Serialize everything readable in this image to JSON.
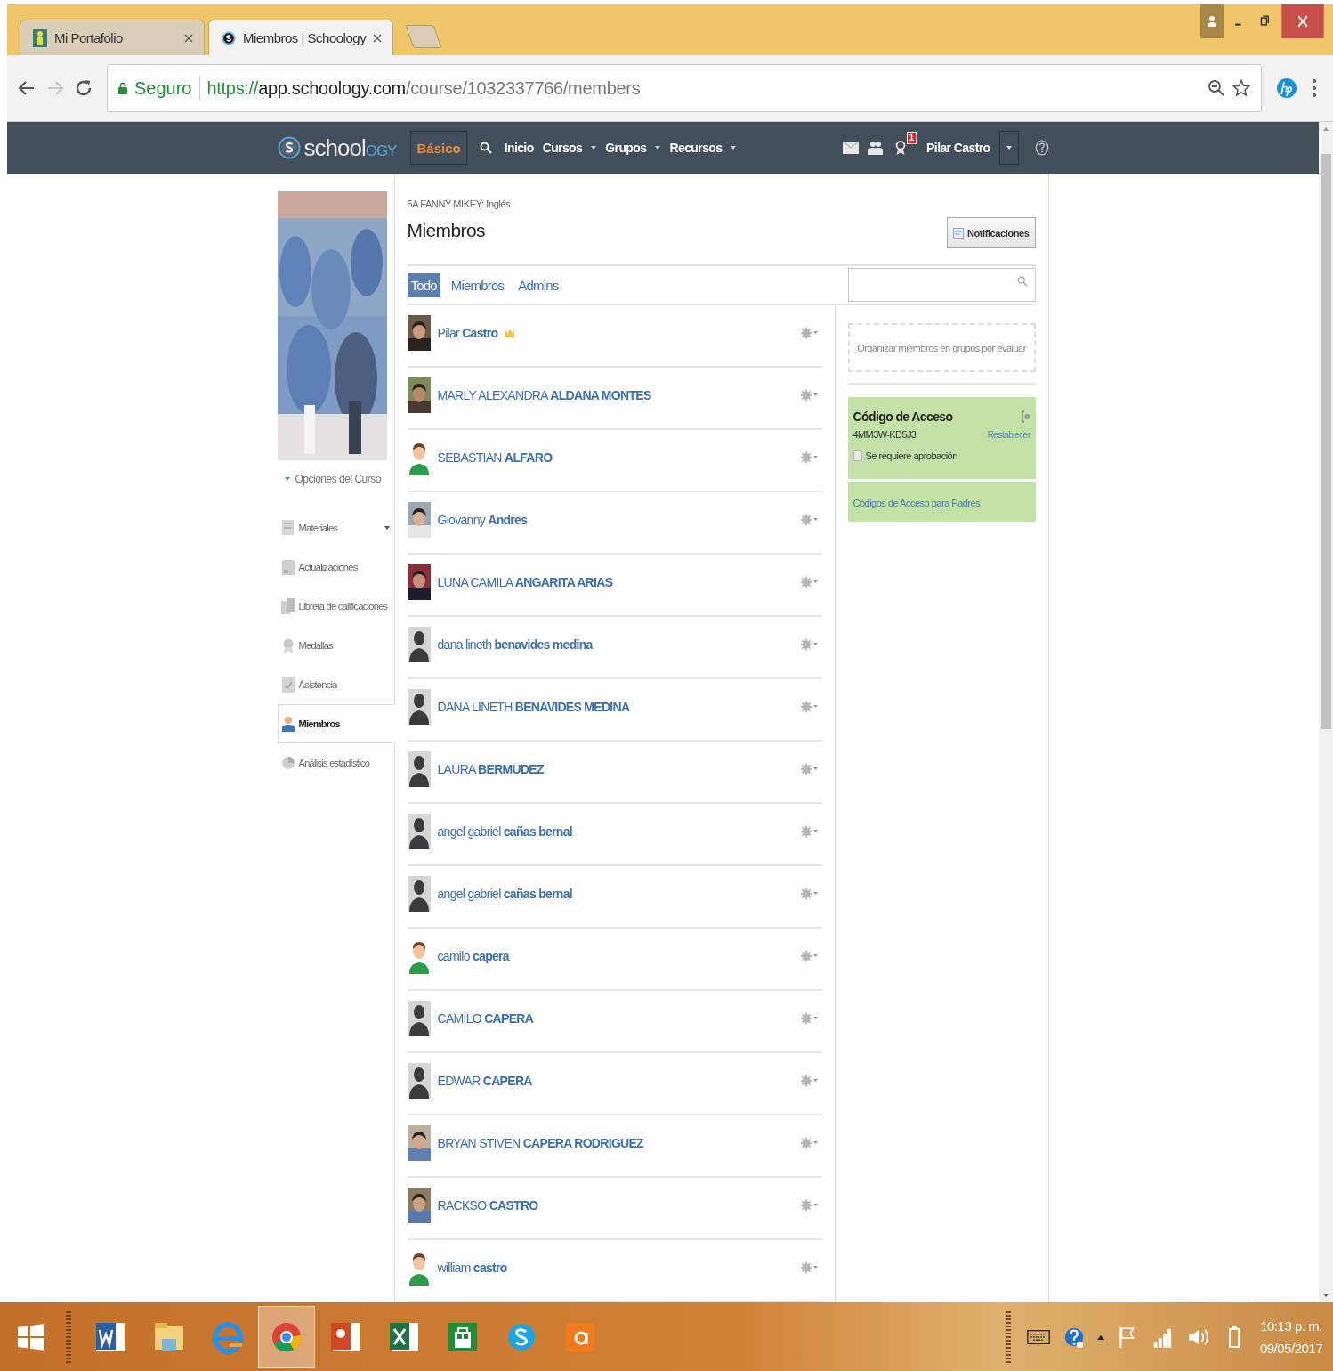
{
  "browser": {
    "tabs": [
      {
        "title": "Mi Portafolio",
        "kind": "portfolio",
        "selected": false
      },
      {
        "title": "Miembros | Schoology",
        "kind": "schoology",
        "selected": true
      }
    ],
    "nav_buttons": [
      {
        "kind": "back",
        "disabled": false
      },
      {
        "kind": "forward",
        "disabled": true
      },
      {
        "kind": "reload",
        "disabled": false
      }
    ],
    "security": "Seguro",
    "url": {
      "scheme": "https://",
      "host": "app.schoology.com",
      "path": "/course/1032337766/members"
    }
  },
  "nav": {
    "logo": {
      "main": "school",
      "accent": "OGY"
    },
    "mode": "Básico",
    "links": [
      {
        "label": "Inicio",
        "menu": false
      },
      {
        "label": "Cursos",
        "menu": true
      },
      {
        "label": "Grupos",
        "menu": true
      },
      {
        "label": "Recursos",
        "menu": true
      }
    ],
    "notification_count": "1",
    "user": "Pilar Castro"
  },
  "sidebar": {
    "options_label": "Opciones del Curso",
    "items": [
      {
        "label": "Materiales",
        "kind": "materials",
        "menu": true,
        "selected": false
      },
      {
        "label": "Actualizaciones",
        "kind": "updates",
        "menu": false,
        "selected": false
      },
      {
        "label": "Libreta de calificaciones",
        "kind": "gradebook",
        "menu": false,
        "selected": false
      },
      {
        "label": "Medallas",
        "kind": "badges",
        "menu": false,
        "selected": false
      },
      {
        "label": "Asistencia",
        "kind": "attendance",
        "menu": false,
        "selected": false
      },
      {
        "label": "Miembros",
        "kind": "members",
        "menu": false,
        "selected": true
      },
      {
        "label": "Análisis estadístico",
        "kind": "analytics",
        "menu": false,
        "selected": false
      }
    ]
  },
  "course": "5A FANNY MIKEY: Inglés",
  "title": "Miembros",
  "notifications_button": "Notificaciones",
  "filter_tabs": [
    {
      "label": "Todo",
      "selected": true
    },
    {
      "label": "Miembros",
      "selected": false
    },
    {
      "label": "Admins",
      "selected": false
    }
  ],
  "members": [
    {
      "name": "Pilar **Castro**",
      "admin": true
    },
    {
      "name": "MARLY ALEXANDRA **ALDANA MONTES**",
      "admin": false
    },
    {
      "name": "SEBASTIAN **ALFARO**",
      "kind": "figure",
      "admin": false
    },
    {
      "name": "Giovanny **Andres**",
      "admin": false
    },
    {
      "name": "LUNA CAMILA **ANGARITA ARIAS**",
      "admin": false
    },
    {
      "name": "dana lineth **benavides medina**",
      "kind": "silhouette",
      "admin": false
    },
    {
      "name": "DANA LINETH **BENAVIDES MEDINA**",
      "kind": "silhouette",
      "admin": false
    },
    {
      "name": "LAURA **BERMUDEZ**",
      "kind": "silhouette",
      "admin": false
    },
    {
      "name": "angel gabriel **cañas bernal**",
      "kind": "silhouette",
      "admin": false
    },
    {
      "name": "angel gabriel **cañas bernal**",
      "kind": "silhouette",
      "admin": false
    },
    {
      "name": "camilo **capera**",
      "kind": "figure",
      "admin": false
    },
    {
      "name": "CAMILO **CAPERA**",
      "kind": "silhouette",
      "admin": false
    },
    {
      "name": "EDWAR **CAPERA**",
      "kind": "silhouette",
      "admin": false
    },
    {
      "name": "BRYAN STIVEN **CAPERA RODRIGUEZ**",
      "admin": false
    },
    {
      "name": "RACKSO **CASTRO**",
      "admin": false
    },
    {
      "name": "william **castro**",
      "kind": "figure",
      "admin": false
    }
  ],
  "groups_prompt": "Organizar miembros en grupos por evaluar",
  "access_code": {
    "title": "Código de Acceso",
    "code": "4MM3W-KD5J3",
    "reset": "Restablecer",
    "approval_label": "Se requiere aprobación",
    "approval_required": false,
    "parent_codes": "Códigos de Acceso para Padres"
  },
  "taskbar": {
    "apps": [
      {
        "kind": "word",
        "selected": false
      },
      {
        "kind": "explorer",
        "selected": false
      },
      {
        "kind": "ie",
        "selected": false
      },
      {
        "kind": "chrome",
        "selected": true
      },
      {
        "kind": "powerpoint",
        "selected": false
      },
      {
        "kind": "excel",
        "selected": false
      },
      {
        "kind": "store",
        "selected": false
      },
      {
        "kind": "skype",
        "selected": false
      },
      {
        "kind": "avast",
        "selected": false
      }
    ],
    "time": "10:13 p. m.",
    "date": "09/05/2017"
  }
}
